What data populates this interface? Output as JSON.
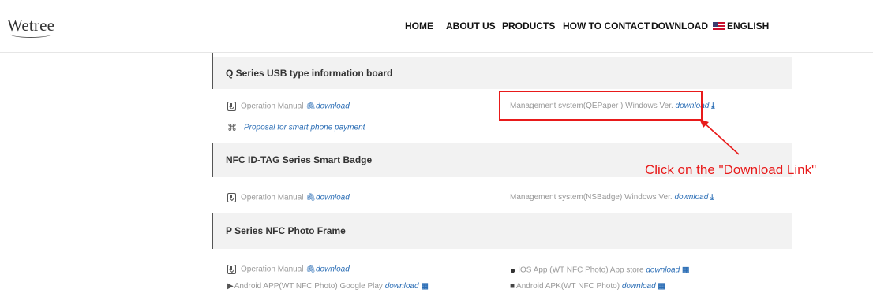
{
  "logo": "Wetree",
  "nav": [
    {
      "label": "HOME"
    },
    {
      "label": "ABOUT US"
    },
    {
      "label": "PRODUCTS"
    },
    {
      "label": "HOW TO CONTACT"
    },
    {
      "label": "DOWNLOAD"
    },
    {
      "label": "ENGLISH"
    }
  ],
  "sections": [
    {
      "title": "Q Series USB type information board",
      "rows": [
        {
          "text": "Operation Manual",
          "link": "download"
        },
        {
          "text": "Management system(QEPaper ) Windows Ver.",
          "link": "download"
        },
        {
          "text": "",
          "link": "Proposal for smart phone payment"
        }
      ]
    },
    {
      "title": "NFC ID-TAG Series Smart Badge",
      "rows": [
        {
          "text": "Operation Manual",
          "link": "download"
        },
        {
          "text": "Management system(NSBadge) Windows Ver.",
          "link": "download"
        }
      ]
    },
    {
      "title": "P Series NFC Photo Frame",
      "rows": [
        {
          "text": "Operation Manual",
          "link": "download"
        },
        {
          "text": "IOS App (WT NFC Photo) App store",
          "link": "download"
        },
        {
          "text": "Android APP(WT NFC Photo) Google Play",
          "link": "download"
        },
        {
          "text": "Android APK(WT NFC Photo)",
          "link": "download"
        }
      ]
    }
  ],
  "annotation": "Click on the \"Download Link\"",
  "colors": {
    "accent": "#2a6db5",
    "annotation": "#e81a1a"
  }
}
